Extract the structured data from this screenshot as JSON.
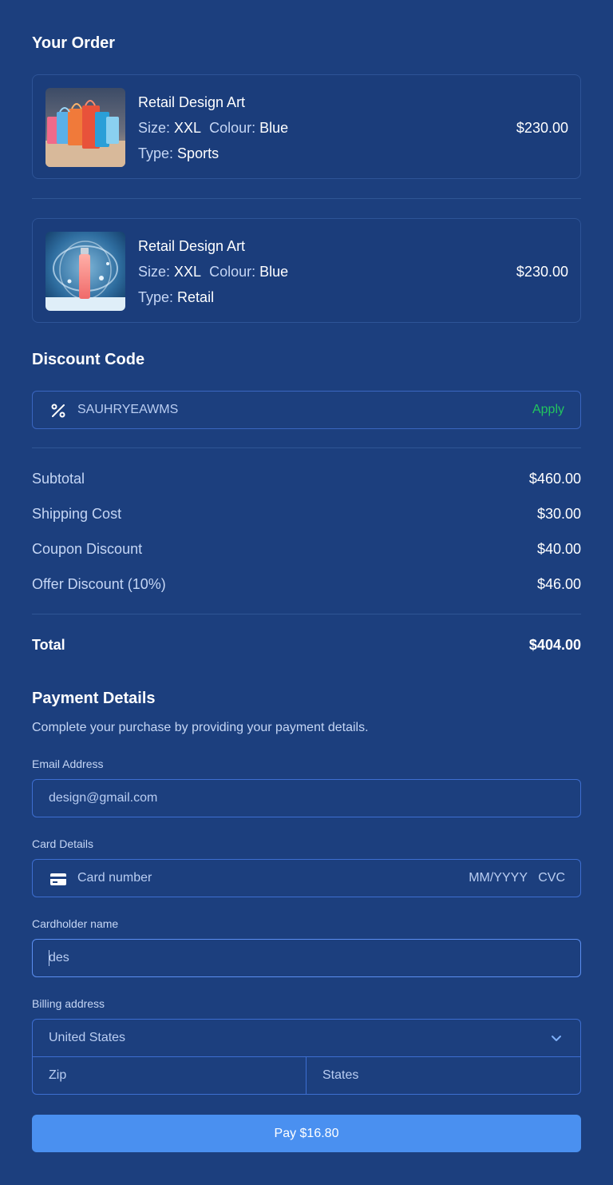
{
  "order": {
    "title": "Your Order",
    "items": [
      {
        "name": "Retail Design Art",
        "size_label": "Size:",
        "size": "XXL",
        "colour_label": "Colour:",
        "colour": "Blue",
        "type_label": "Type:",
        "type": "Sports",
        "price": "$230.00",
        "image": "shopping-bags-photo"
      },
      {
        "name": "Retail Design Art",
        "size_label": "Size:",
        "size": "XXL",
        "colour_label": "Colour:",
        "colour": "Blue",
        "type_label": "Type:",
        "type": "Retail",
        "price": "$230.00",
        "image": "perfume-bottle-photo"
      }
    ]
  },
  "discount": {
    "title": "Discount Code",
    "code": "SAUHRYEAWMS",
    "apply_label": "Apply",
    "icon": "percent-icon"
  },
  "summary": {
    "subtotal_label": "Subtotal",
    "subtotal": "$460.00",
    "shipping_label": "Shipping Cost",
    "shipping": "$30.00",
    "coupon_label": "Coupon Discount",
    "coupon": "$40.00",
    "offer_label": "Offer Discount (10%)",
    "offer": "$46.00",
    "total_label": "Total",
    "total": "$404.00"
  },
  "payment": {
    "title": "Payment Details",
    "subtitle": "Complete your purchase by providing your payment details.",
    "email_label": "Email Address",
    "email_value": "design@gmail.com",
    "card_label": "Card Details",
    "card_placeholder": "Card number",
    "expiry_placeholder": "MM/YYYY",
    "cvc_placeholder": "CVC",
    "cardholder_label": "Cardholder name",
    "cardholder_value": "des",
    "billing_label": "Billing address",
    "country": "United States",
    "zip_placeholder": "Zip",
    "state_placeholder": "States",
    "pay_label": "Pay $16.80"
  },
  "colors": {
    "background": "#1c3f7e",
    "accent": "#4a90f0",
    "apply": "#22c55e",
    "input_border": "#3d6ed0"
  }
}
